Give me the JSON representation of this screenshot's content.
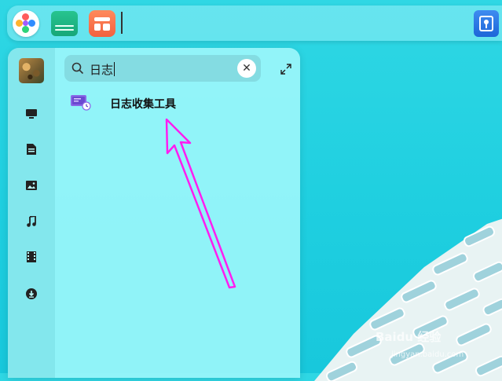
{
  "dock": {
    "launcher_icon": "launcher-icon",
    "file_manager_icon": "file-manager-icon",
    "app_store_icon": "app-store-icon",
    "tray_icon": "notification-tray-icon"
  },
  "launcher": {
    "search": {
      "value": "日志"
    },
    "sidebar": [
      "computer-icon",
      "document-icon",
      "picture-icon",
      "music-icon",
      "video-icon",
      "download-icon"
    ],
    "results": [
      {
        "label": "日志收集工具",
        "icon": "log-collector-icon"
      }
    ]
  },
  "watermark": {
    "text": "Baidu 经验",
    "sub": "jingyan.baidu.com"
  },
  "colors": {
    "accent_arrow": "#ff1ef0",
    "background": "#1fcfe0"
  }
}
